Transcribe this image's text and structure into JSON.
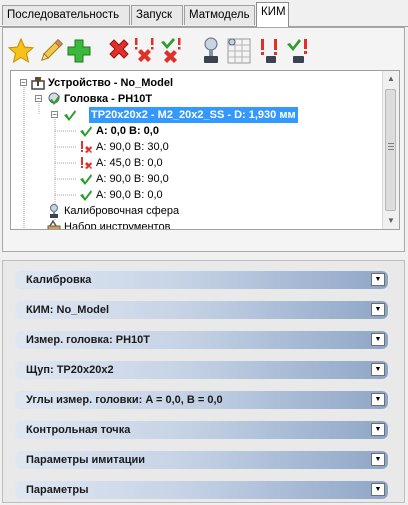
{
  "tabs": [
    {
      "label": "Последовательность"
    },
    {
      "label": "Запуск"
    },
    {
      "label": "Матмодель"
    },
    {
      "label": "КИМ"
    }
  ],
  "toolbar": {
    "buttons": [
      "star-icon",
      "pencil-icon",
      "add-icon",
      "delete-icon",
      "delete-warning-icon",
      "check-delete-icon",
      "probe-icon",
      "grid-icon",
      "warning-icon",
      "check-warning-icon"
    ]
  },
  "tree": {
    "device": "Устройство - No_Model",
    "head": "Головка - PH10T",
    "stylus": "TP20x20x2 - M2_20x2_SS - D: 1,930 мм",
    "angles": [
      {
        "label": "A: 0,0 B: 0,0",
        "status": "ok",
        "bold": true
      },
      {
        "label": "A: 90,0 B: 30,0",
        "status": "warn"
      },
      {
        "label": "A: 45,0 B: 0,0",
        "status": "warn"
      },
      {
        "label": "A: 90,0 B: 90,0",
        "status": "ok"
      },
      {
        "label": "A: 90,0 B: 0,0",
        "status": "ok"
      }
    ],
    "sphere": "Калибровочная сфера",
    "tools": "Набор инструментов"
  },
  "sections": [
    {
      "label": "Калибровка"
    },
    {
      "label": "КИМ: No_Model"
    },
    {
      "label": "Измер. головка: PH10T"
    },
    {
      "label": "Щуп: TP20x20x2"
    },
    {
      "label": "Углы измер. головки: A = 0,0, B = 0,0"
    },
    {
      "label": "Контрольная точка"
    },
    {
      "label": "Параметры имитации"
    },
    {
      "label": "Параметры"
    }
  ],
  "colors": {
    "selection": "#3399ff",
    "ok": "#2a9d2a",
    "error": "#e02020",
    "section_gradient_end": "#8ea6c7"
  }
}
